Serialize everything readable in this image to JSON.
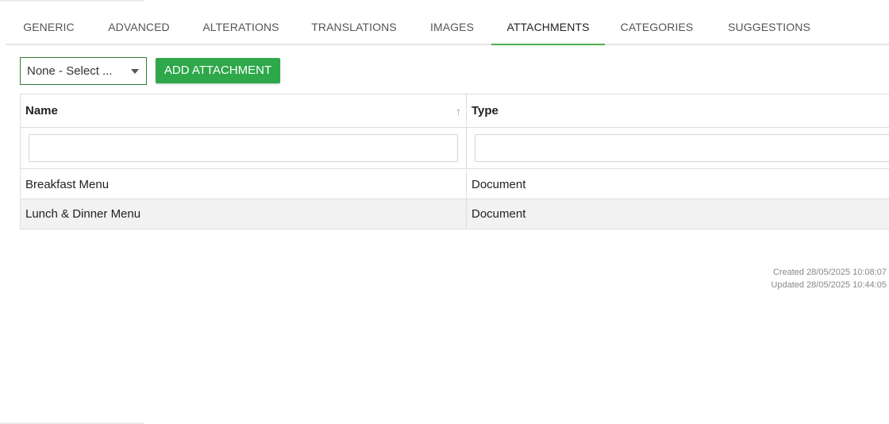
{
  "tabs": [
    {
      "label": "GENERIC",
      "active": false
    },
    {
      "label": "ADVANCED",
      "active": false
    },
    {
      "label": "ALTERATIONS",
      "active": false
    },
    {
      "label": "TRANSLATIONS",
      "active": false
    },
    {
      "label": "IMAGES",
      "active": false
    },
    {
      "label": "ATTACHMENTS",
      "active": true
    },
    {
      "label": "CATEGORIES",
      "active": false
    },
    {
      "label": "SUGGESTIONS",
      "active": false
    }
  ],
  "toolbar": {
    "select_value": "None - Select ...",
    "add_label": "ADD ATTACHMENT"
  },
  "colors": {
    "accent": "#4caf50",
    "button": "#2ea84a"
  },
  "table": {
    "columns": [
      {
        "label": "Name",
        "sort": "asc"
      },
      {
        "label": "Type"
      }
    ],
    "filters": [
      "",
      ""
    ],
    "rows": [
      {
        "name": "Breakfast Menu",
        "type": "Document"
      },
      {
        "name": "Lunch & Dinner Menu",
        "type": "Document"
      }
    ]
  },
  "meta": {
    "created": "Created 28/05/2025 10:08:07",
    "updated": "Updated 28/05/2025 10:44:05"
  }
}
